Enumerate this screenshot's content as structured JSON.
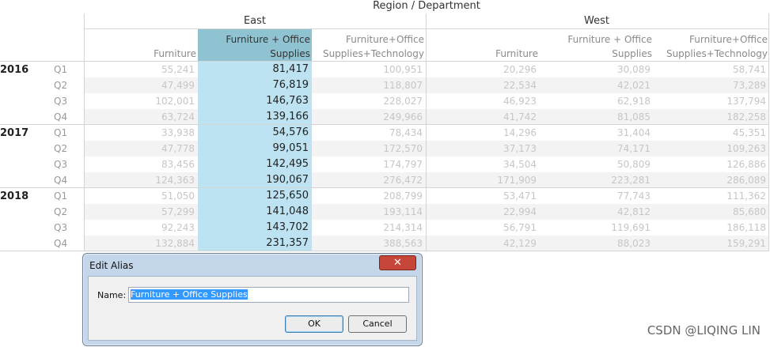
{
  "dimension_title": "Region / Department",
  "regions": [
    "East",
    "West"
  ],
  "columns": {
    "east": [
      "Furniture",
      "Furniture + Office Supplies",
      "Furniture+Office Supplies+Technology"
    ],
    "west": [
      "Furniture",
      "Furniture + Office Supplies",
      "Furniture+Office Supplies+Technology"
    ]
  },
  "column_header_lines": [
    [
      "",
      "Furniture"
    ],
    [
      "Furniture + Office",
      "Supplies"
    ],
    [
      "Furniture+Office",
      "Supplies+Technology"
    ],
    [
      "",
      "Furniture"
    ],
    [
      "Furniture + Office",
      "Supplies"
    ],
    [
      "Furniture+Office",
      "Supplies+Technology"
    ]
  ],
  "selected_column_index": 1,
  "years": [
    {
      "year": "2016",
      "rows": [
        {
          "q": "Q1",
          "v": [
            "55,241",
            "81,417",
            "100,951",
            "20,296",
            "30,089",
            "58,741"
          ]
        },
        {
          "q": "Q2",
          "v": [
            "47,499",
            "76,819",
            "118,807",
            "22,534",
            "42,021",
            "73,289"
          ]
        },
        {
          "q": "Q3",
          "v": [
            "102,001",
            "146,763",
            "228,027",
            "46,923",
            "62,918",
            "137,794"
          ]
        },
        {
          "q": "Q4",
          "v": [
            "63,724",
            "139,166",
            "249,966",
            "41,742",
            "81,085",
            "182,258"
          ]
        }
      ]
    },
    {
      "year": "2017",
      "rows": [
        {
          "q": "Q1",
          "v": [
            "33,938",
            "54,576",
            "78,434",
            "14,296",
            "31,404",
            "45,351"
          ]
        },
        {
          "q": "Q2",
          "v": [
            "47,778",
            "99,051",
            "172,570",
            "37,173",
            "74,171",
            "109,263"
          ]
        },
        {
          "q": "Q3",
          "v": [
            "83,456",
            "142,495",
            "174,797",
            "34,504",
            "50,809",
            "126,886"
          ]
        },
        {
          "q": "Q4",
          "v": [
            "124,363",
            "190,067",
            "276,472",
            "171,909",
            "223,281",
            "286,089"
          ]
        }
      ]
    },
    {
      "year": "2018",
      "rows": [
        {
          "q": "Q1",
          "v": [
            "51,050",
            "125,650",
            "208,799",
            "53,471",
            "77,743",
            "111,362"
          ]
        },
        {
          "q": "Q2",
          "v": [
            "57,299",
            "141,048",
            "193,114",
            "22,994",
            "42,812",
            "85,680"
          ]
        },
        {
          "q": "Q3",
          "v": [
            "92,243",
            "143,702",
            "214,314",
            "56,791",
            "119,691",
            "186,118"
          ]
        },
        {
          "q": "Q4",
          "v": [
            "132,884",
            "231,357",
            "388,563",
            "42,129",
            "88,023",
            "159,291"
          ]
        }
      ]
    }
  ],
  "colors": {
    "selected_header": "#8fc3d1",
    "selected_cells": "#bde3f2",
    "band": "#f3f3f3",
    "selection_text": "#3399ff"
  },
  "dialog": {
    "title": "Edit Alias",
    "close_glyph": "✕",
    "name_label": "Name:",
    "name_value": "Furniture + Office Supplies",
    "ok_label": "OK",
    "cancel_label": "Cancel"
  },
  "watermark": "CSDN @LIQING LIN"
}
